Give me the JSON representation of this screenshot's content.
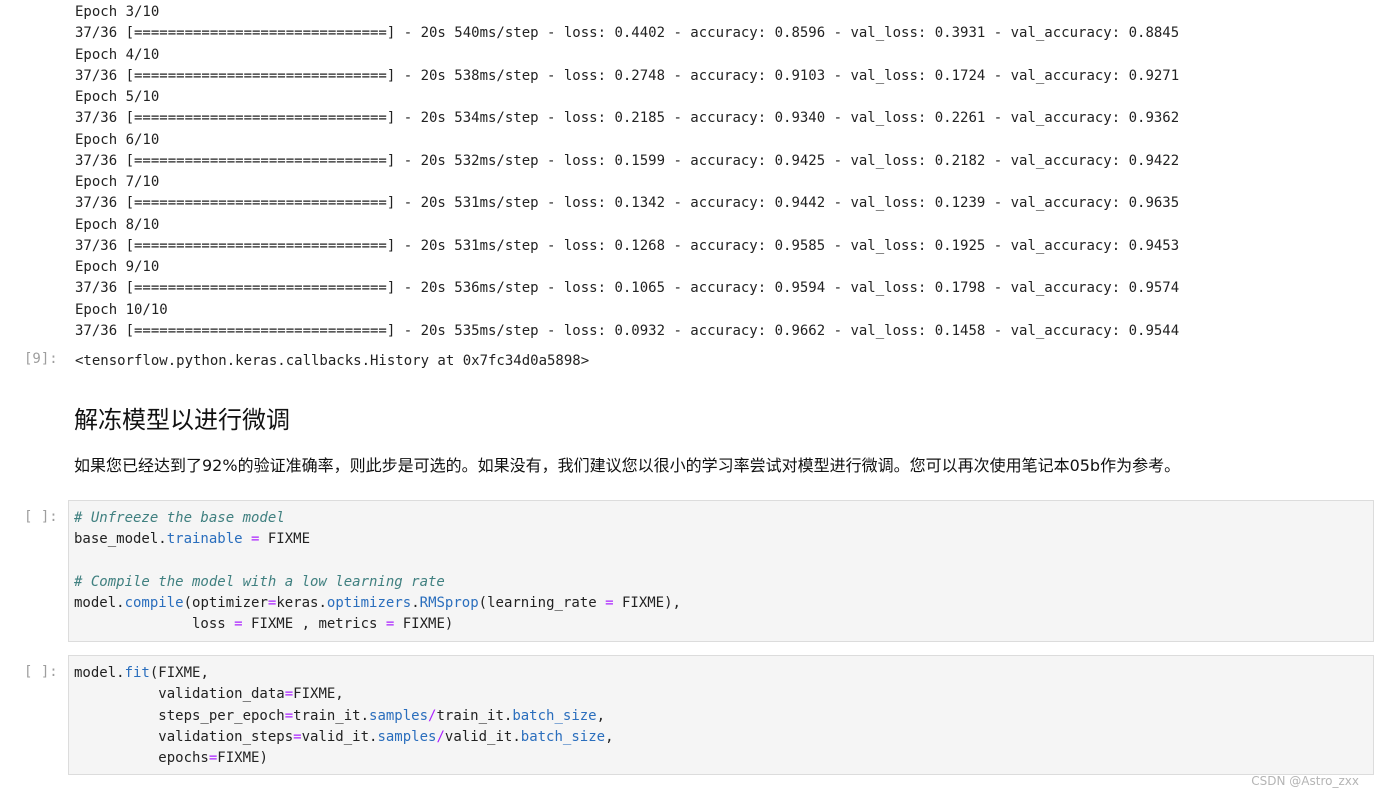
{
  "training_output": [
    "Epoch 3/10",
    "37/36 [==============================] - 20s 540ms/step - loss: 0.4402 - accuracy: 0.8596 - val_loss: 0.3931 - val_accuracy: 0.8845",
    "Epoch 4/10",
    "37/36 [==============================] - 20s 538ms/step - loss: 0.2748 - accuracy: 0.9103 - val_loss: 0.1724 - val_accuracy: 0.9271",
    "Epoch 5/10",
    "37/36 [==============================] - 20s 534ms/step - loss: 0.2185 - accuracy: 0.9340 - val_loss: 0.2261 - val_accuracy: 0.9362",
    "Epoch 6/10",
    "37/36 [==============================] - 20s 532ms/step - loss: 0.1599 - accuracy: 0.9425 - val_loss: 0.2182 - val_accuracy: 0.9422",
    "Epoch 7/10",
    "37/36 [==============================] - 20s 531ms/step - loss: 0.1342 - accuracy: 0.9442 - val_loss: 0.1239 - val_accuracy: 0.9635",
    "Epoch 8/10",
    "37/36 [==============================] - 20s 531ms/step - loss: 0.1268 - accuracy: 0.9585 - val_loss: 0.1925 - val_accuracy: 0.9453",
    "Epoch 9/10",
    "37/36 [==============================] - 20s 536ms/step - loss: 0.1065 - accuracy: 0.9594 - val_loss: 0.1798 - val_accuracy: 0.9574",
    "Epoch 10/10",
    "37/36 [==============================] - 20s 535ms/step - loss: 0.0932 - accuracy: 0.9662 - val_loss: 0.1458 - val_accuracy: 0.9544"
  ],
  "result": {
    "prompt": "[9]:",
    "text": "<tensorflow.python.keras.callbacks.History at 0x7fc34d0a5898>"
  },
  "markdown": {
    "heading": "解冻模型以进行微调",
    "paragraph": "如果您已经达到了92%的验证准确率，则此步是可选的。如果没有，我们建议您以很小的学习率尝试对模型进行微调。您可以再次使用笔记本05b作为参考。"
  },
  "cells": [
    {
      "prompt": "[ ]:",
      "lines": [
        [
          {
            "t": "# Unfreeze the base model",
            "c": "cm"
          }
        ],
        [
          {
            "t": "base_model."
          },
          {
            "t": "trainable",
            "c": "attr"
          },
          {
            "t": " "
          },
          {
            "t": "=",
            "c": "op"
          },
          {
            "t": " FIXME"
          }
        ],
        [
          {
            "t": ""
          }
        ],
        [
          {
            "t": "# Compile the model with a low learning rate",
            "c": "cm"
          }
        ],
        [
          {
            "t": "model."
          },
          {
            "t": "compile",
            "c": "attr"
          },
          {
            "t": "(optimizer"
          },
          {
            "t": "=",
            "c": "op"
          },
          {
            "t": "keras."
          },
          {
            "t": "optimizers",
            "c": "attr"
          },
          {
            "t": "."
          },
          {
            "t": "RMSprop",
            "c": "attr"
          },
          {
            "t": "(learning_rate "
          },
          {
            "t": "=",
            "c": "op"
          },
          {
            "t": " FIXME),"
          }
        ],
        [
          {
            "t": "              loss "
          },
          {
            "t": "=",
            "c": "op"
          },
          {
            "t": " FIXME , metrics "
          },
          {
            "t": "=",
            "c": "op"
          },
          {
            "t": " FIXME)"
          }
        ]
      ]
    },
    {
      "prompt": "[ ]:",
      "lines": [
        [
          {
            "t": "model."
          },
          {
            "t": "fit",
            "c": "attr"
          },
          {
            "t": "(FIXME,"
          }
        ],
        [
          {
            "t": "          validation_data"
          },
          {
            "t": "=",
            "c": "op"
          },
          {
            "t": "FIXME,"
          }
        ],
        [
          {
            "t": "          steps_per_epoch"
          },
          {
            "t": "=",
            "c": "op"
          },
          {
            "t": "train_it."
          },
          {
            "t": "samples",
            "c": "attr"
          },
          {
            "t": "/",
            "c": "op"
          },
          {
            "t": "train_it."
          },
          {
            "t": "batch_size",
            "c": "attr"
          },
          {
            "t": ","
          }
        ],
        [
          {
            "t": "          validation_steps"
          },
          {
            "t": "=",
            "c": "op"
          },
          {
            "t": "valid_it."
          },
          {
            "t": "samples",
            "c": "attr"
          },
          {
            "t": "/",
            "c": "op"
          },
          {
            "t": "valid_it."
          },
          {
            "t": "batch_size",
            "c": "attr"
          },
          {
            "t": ","
          }
        ],
        [
          {
            "t": "          epochs"
          },
          {
            "t": "=",
            "c": "op"
          },
          {
            "t": "FIXME)"
          }
        ]
      ]
    }
  ],
  "watermark": "CSDN @Astro_zxx"
}
